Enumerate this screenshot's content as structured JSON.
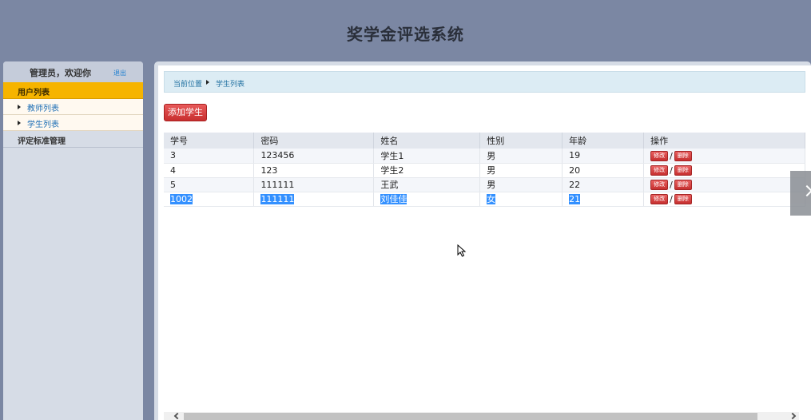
{
  "header": {
    "title": "奖学金评选系统"
  },
  "sidebar": {
    "welcome": "管理员，欢迎你",
    "logout": "退出",
    "group": "用户列表",
    "items": [
      {
        "label": "教师列表"
      },
      {
        "label": "学生列表"
      }
    ],
    "plain": "评定标准管理"
  },
  "breadcrumb": {
    "current": "当前位置",
    "page": "学生列表"
  },
  "toolbar": {
    "add_label": "添加学生"
  },
  "table": {
    "headers": [
      "学号",
      "密码",
      "姓名",
      "性别",
      "年龄",
      "操作"
    ],
    "rows": [
      [
        "3",
        "123456",
        "学生1",
        "男",
        "19"
      ],
      [
        "4",
        "123",
        "学生2",
        "男",
        "20"
      ],
      [
        "5",
        "111111",
        "王武",
        "男",
        "22"
      ],
      [
        "1002",
        "111111",
        "刘佳佳",
        "女",
        "21"
      ]
    ],
    "edit_label": "修改",
    "delete_label": "删除",
    "separator": "/"
  }
}
